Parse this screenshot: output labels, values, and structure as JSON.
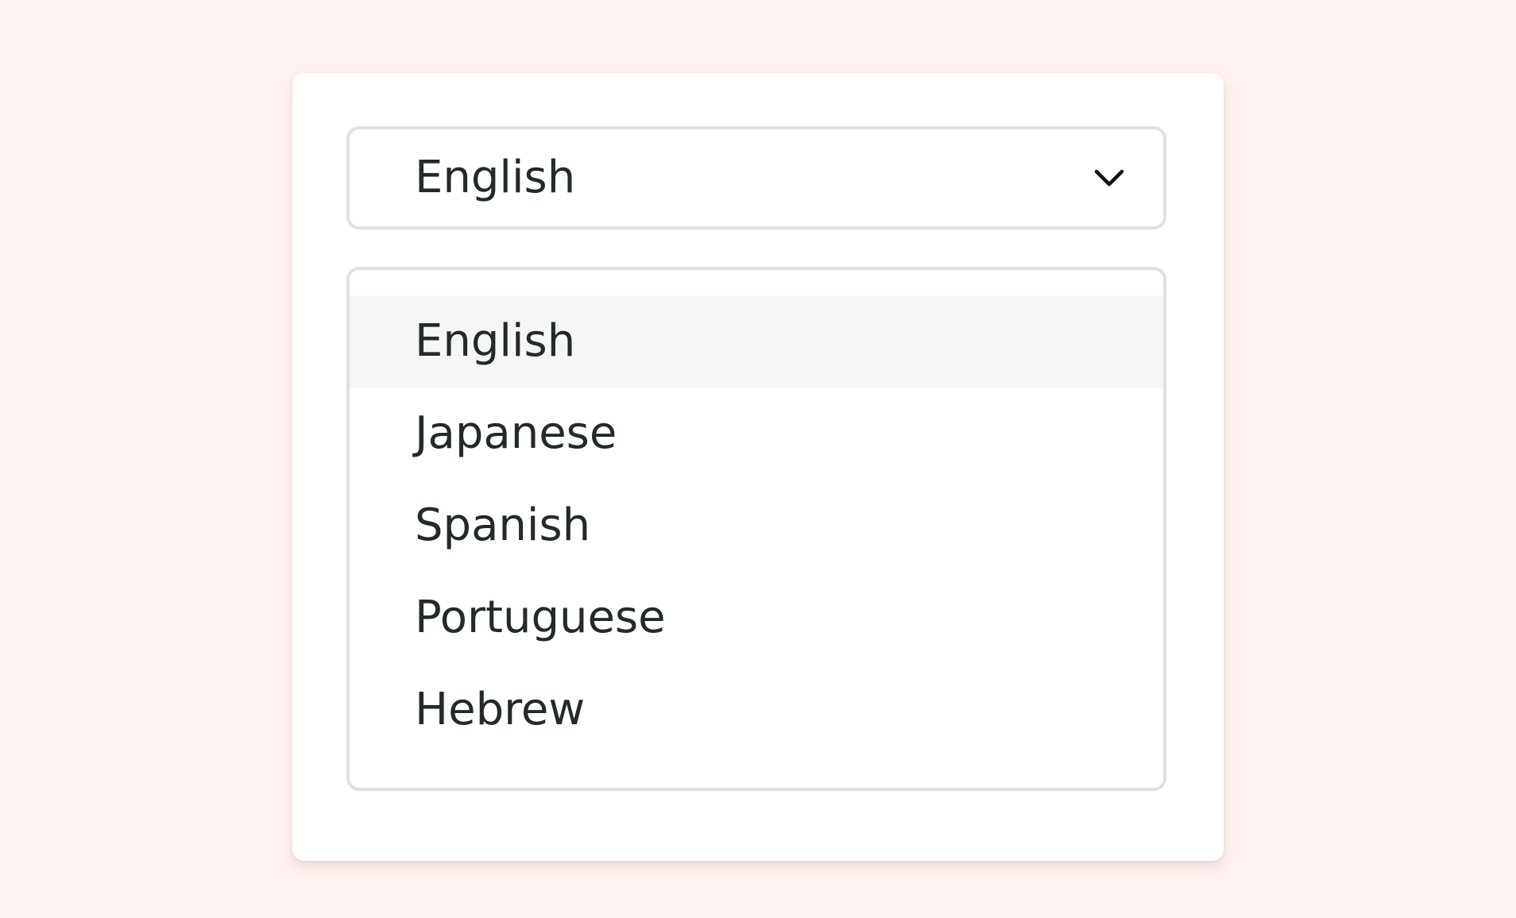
{
  "colors": {
    "page_background": "#fff2f0",
    "card_background": "#ffffff",
    "border": "#e1e1e1",
    "highlight": "#f6f6f6",
    "text": "#232b2a"
  },
  "select": {
    "selected_value": "English",
    "icon": "chevron-down-icon"
  },
  "dropdown": {
    "highlighted_index": 0,
    "options": [
      {
        "label": "English"
      },
      {
        "label": "Japanese"
      },
      {
        "label": "Spanish"
      },
      {
        "label": "Portuguese"
      },
      {
        "label": "Hebrew"
      }
    ]
  }
}
